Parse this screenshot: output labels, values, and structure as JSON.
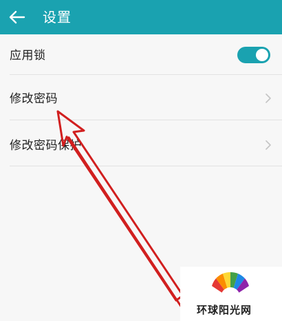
{
  "header": {
    "title": "设置",
    "back_icon": "arrow-left-icon"
  },
  "settings": {
    "app_lock": {
      "label": "应用锁",
      "enabled": true
    },
    "change_password": {
      "label": "修改密码",
      "icon": "chevron-right-icon"
    },
    "change_password_protection": {
      "label": "修改密码保护",
      "icon": "chevron-right-icon"
    }
  },
  "watermark": {
    "text": "环球阳光网"
  },
  "colors": {
    "accent": "#1aa2b0",
    "annotation_arrow": "#d11f1f",
    "background": "#f7f7f7",
    "divider": "#e2e2e2"
  }
}
